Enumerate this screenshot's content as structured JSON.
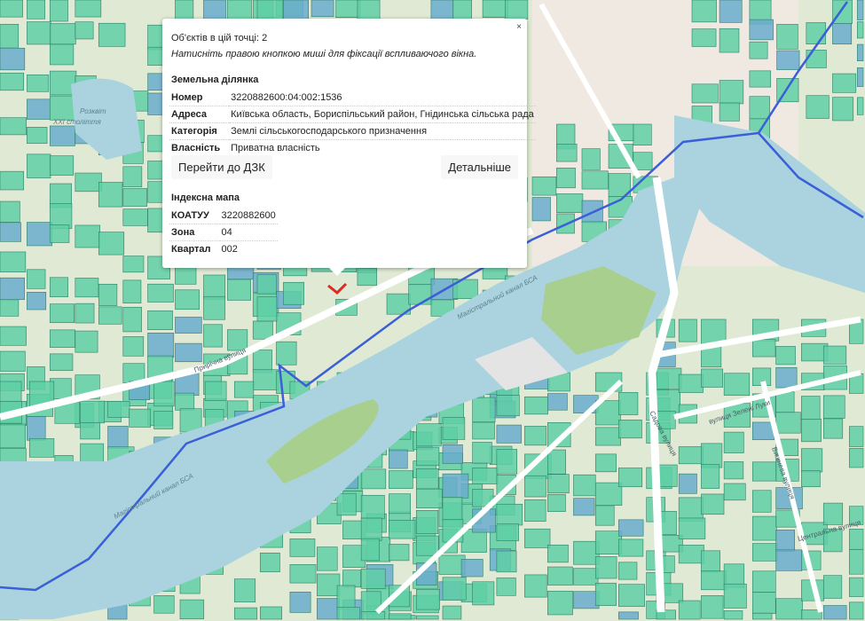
{
  "map": {
    "labels": {
      "park": "Розквіт",
      "park2": "XXI століття",
      "street1": "Прирічна вулиця",
      "canal1": "Магістральний канал БСА",
      "canal2": "Магістральний канал БСА",
      "street2": "Садова вулиця",
      "street3": "вулиця Зелені Луки",
      "street4": "Вишнева вулиця",
      "street5": "Центральна вулиця"
    },
    "colors": {
      "parcel": "#5fcfa5",
      "parcel_blue": "#6aaccc",
      "water": "#aad3df",
      "boundary": "#3b5fd6",
      "marker": "#d92b1f"
    }
  },
  "popup": {
    "close": "×",
    "objects_count": "Об'єктів в цій точці: 2",
    "hint": "Натисніть правою кнопкою миші для фіксації вспливаючого вікна.",
    "land_section": "Земельна ділянка",
    "land_rows": [
      {
        "key": "Номер",
        "value": "3220882600:04:002:1536"
      },
      {
        "key": "Адреса",
        "value": "Київська область, Бориспільський район, Гнідинська сільська рада"
      },
      {
        "key": "Категорія",
        "value": "Землі сільськогосподарського призначення"
      },
      {
        "key": "Власність",
        "value": "Приватна власність"
      }
    ],
    "btn_dzk": "Перейти до ДЗК",
    "btn_details": "Детальніше",
    "index_section": "Індексна мапа",
    "index_rows": [
      {
        "key": "КОАТУУ",
        "value": "3220882600"
      },
      {
        "key": "Зона",
        "value": "04"
      },
      {
        "key": "Квартал",
        "value": "002"
      }
    ]
  }
}
